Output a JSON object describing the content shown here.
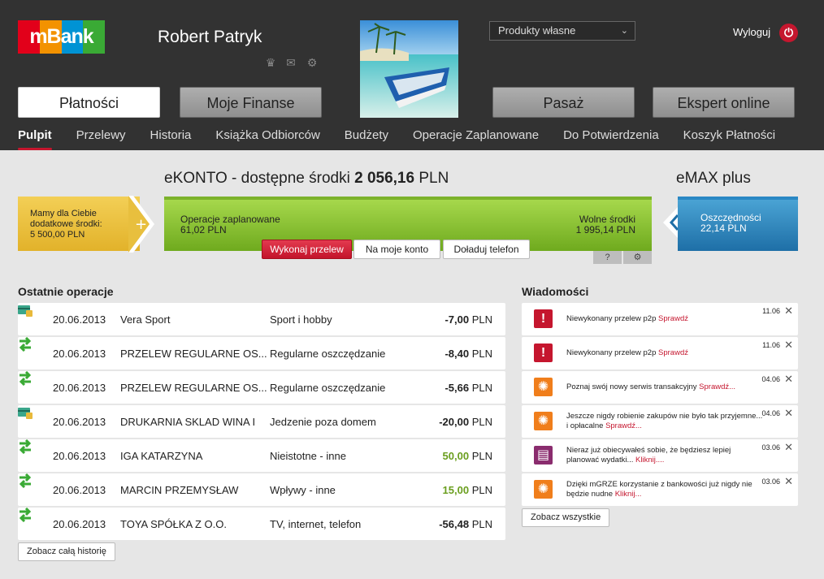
{
  "brand": {
    "logo_text": "mBank",
    "logo_colors": [
      "#e2001a",
      "#f39200",
      "#0093d4",
      "#3aaa35"
    ]
  },
  "user": {
    "name": "Robert Patryk"
  },
  "header": {
    "select_value": "Produkty własne",
    "logout_label": "Wyloguj",
    "main_nav": [
      "Płatności",
      "Moje Finanse",
      "Pasaż",
      "Ekspert online"
    ],
    "sub_nav": [
      "Pulpit",
      "Przelewy",
      "Historia",
      "Książka Odbiorców",
      "Budżety",
      "Operacje Zaplanowane",
      "Do Potwierdzenia",
      "Koszyk Płatności"
    ]
  },
  "account": {
    "title_prefix": "eKONTO - dostępne środki ",
    "balance": "2 056,16",
    "currency": " PLN",
    "emax_title": "eMAX plus",
    "offer_line1": "Mamy dla Ciebie",
    "offer_line2": "dodatkowe środki:",
    "offer_amount": "5 500,00 PLN",
    "planned_label": "Operacje zaplanowane",
    "planned_amount": "61,02 PLN",
    "free_label": "Wolne środki",
    "free_amount": "1 995,14 PLN",
    "savings_label": "Oszczędności",
    "savings_amount": "22,14 PLN",
    "btn_transfer": "Wykonaj przelew",
    "btn_own": "Na moje konto",
    "btn_topup": "Doładuj telefon",
    "help_label": "?",
    "settings_icon": "gear-icon"
  },
  "operations": {
    "title": "Ostatnie operacje",
    "show_all": "Zobacz całą historię",
    "rows": [
      {
        "icon": "card-icon",
        "date": "20.06.2013",
        "name": "Vera Sport",
        "category": "Sport i hobby",
        "amount": "-7,00",
        "currency": " PLN",
        "positive": false
      },
      {
        "icon": "transfer-icon",
        "date": "20.06.2013",
        "name": "PRZELEW REGULARNE OS...",
        "category": "Regularne oszczędzanie",
        "amount": "-8,40",
        "currency": " PLN",
        "positive": false
      },
      {
        "icon": "transfer-icon",
        "date": "20.06.2013",
        "name": "PRZELEW REGULARNE OS...",
        "category": "Regularne oszczędzanie",
        "amount": "-5,66",
        "currency": " PLN",
        "positive": false
      },
      {
        "icon": "card-icon",
        "date": "20.06.2013",
        "name": "DRUKARNIA SKLAD WINA I",
        "category": "Jedzenie poza domem",
        "amount": "-20,00",
        "currency": " PLN",
        "positive": false
      },
      {
        "icon": "transfer-icon",
        "date": "20.06.2013",
        "name": "IGA KATARZYNA",
        "category": "Nieistotne - inne",
        "amount": "50,00",
        "currency": " PLN",
        "positive": true
      },
      {
        "icon": "transfer-icon",
        "date": "20.06.2013",
        "name": "MARCIN PRZEMYSŁAW",
        "category": "Wpływy - inne",
        "amount": "15,00",
        "currency": " PLN",
        "positive": true
      },
      {
        "icon": "transfer-icon",
        "date": "20.06.2013",
        "name": "TOYA SPÓŁKA Z O.O.",
        "category": "TV, internet, telefon",
        "amount": "-56,48",
        "currency": " PLN",
        "positive": false
      }
    ]
  },
  "messages": {
    "title": "Wiadomości",
    "show_all": "Zobacz wszystkie",
    "items": [
      {
        "icon": "alert-icon",
        "color": "#c5162e",
        "text": "Niewykonany przelew p2p ",
        "link": "Sprawdź",
        "date": "11.06"
      },
      {
        "icon": "alert-icon",
        "color": "#c5162e",
        "text": "Niewykonany przelew p2p ",
        "link": "Sprawdź",
        "date": "11.06"
      },
      {
        "icon": "lightbulb-icon",
        "color": "#f07e1b",
        "text": "Poznaj swój nowy serwis transakcyjny ",
        "link": "Sprawdź...",
        "date": "04.06"
      },
      {
        "icon": "lightbulb-icon",
        "color": "#f07e1b",
        "text": "Jeszcze nigdy robienie zakupów nie było tak przyjemne... i opłacalne ",
        "link": "Sprawdź...",
        "date": "04.06"
      },
      {
        "icon": "budget-alert-icon",
        "color": "#8a2c6e",
        "text": "Nieraz już obiecywałeś sobie, że będziesz lepiej planować wydatki... ",
        "link": "Kliknij....",
        "date": "03.06"
      },
      {
        "icon": "lightbulb-icon",
        "color": "#f07e1b",
        "text": "Dzięki mGRZE korzystanie z bankowości już nigdy nie będzie nudne ",
        "link": "Kliknij...",
        "date": "03.06"
      }
    ]
  }
}
